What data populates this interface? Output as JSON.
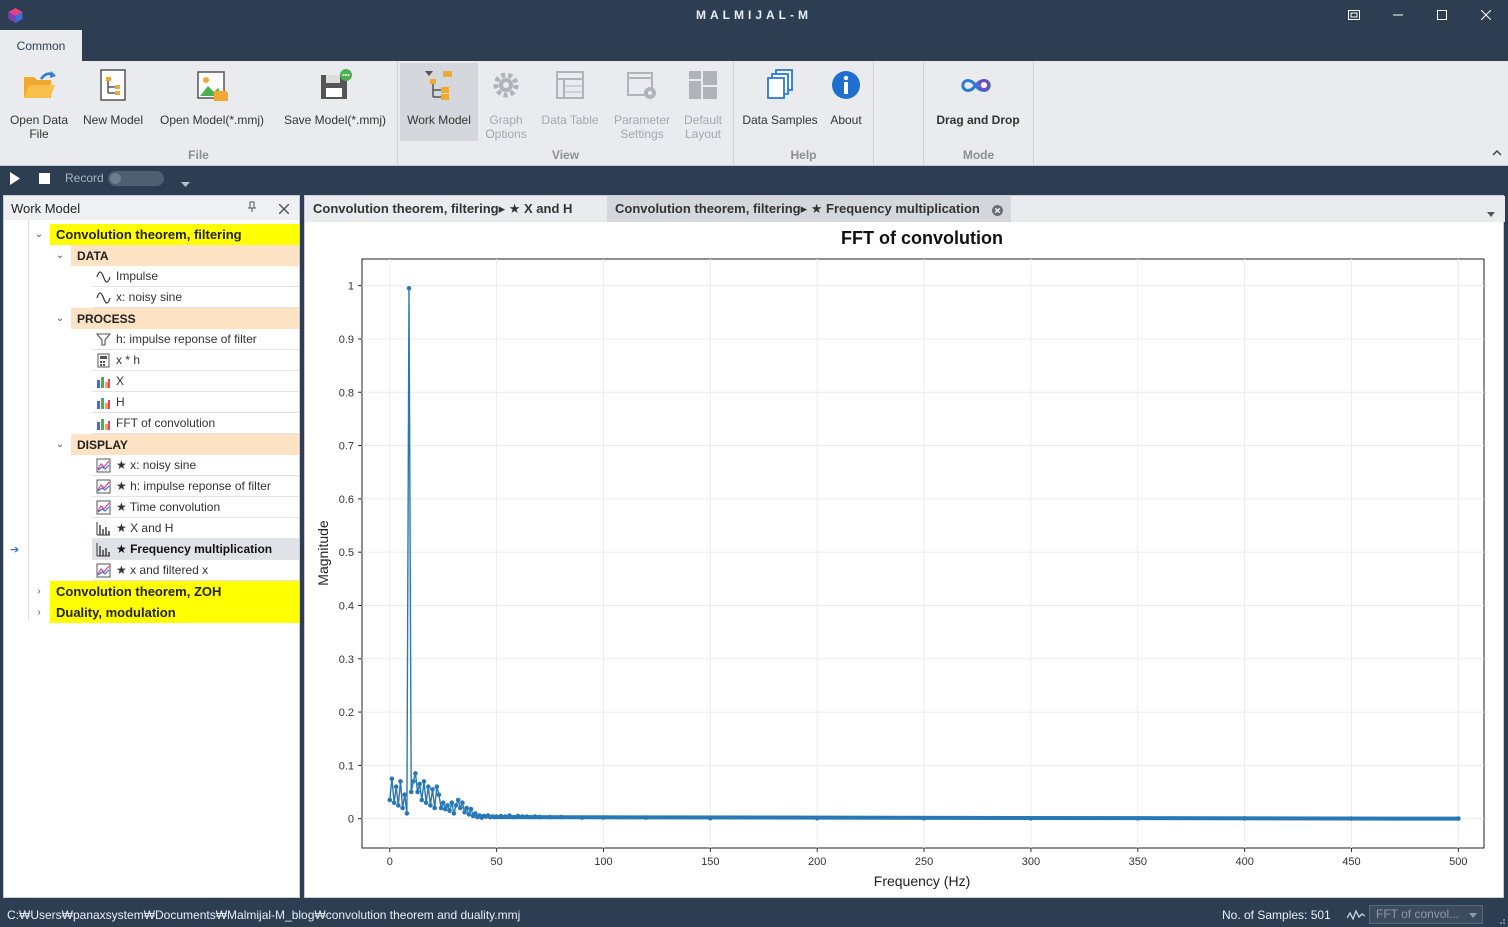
{
  "window": {
    "title": "MALMIJAL-M",
    "controls": [
      "restore",
      "minimize",
      "maximize",
      "close"
    ]
  },
  "ribbon": {
    "tab": "Common",
    "groups": [
      {
        "label": "File",
        "buttons": [
          {
            "label": "Open Data File",
            "icon": "open-folder-icon"
          },
          {
            "label": "New Model",
            "icon": "new-model-icon"
          },
          {
            "label": "Open Model(*.mmj)",
            "icon": "open-model-icon"
          },
          {
            "label": "Save Model(*.mmj)",
            "icon": "save-model-icon"
          }
        ]
      },
      {
        "label": "View",
        "buttons": [
          {
            "label": "Work Model",
            "icon": "work-model-icon",
            "active": true
          },
          {
            "label": "Graph Options",
            "icon": "gear-icon",
            "disabled": true
          },
          {
            "label": "Data Table",
            "icon": "table-icon",
            "disabled": true
          },
          {
            "label": "Parameter Settings",
            "icon": "parameter-settings-icon",
            "disabled": true
          },
          {
            "label": "Default Layout",
            "icon": "layout-icon",
            "disabled": true
          }
        ]
      },
      {
        "label": "Help",
        "buttons": [
          {
            "label": "Data Samples",
            "icon": "data-samples-icon"
          },
          {
            "label": "About",
            "icon": "info-icon"
          }
        ]
      },
      {
        "label": "Mode",
        "buttons": [
          {
            "label": "Drag and Drop",
            "icon": "infinity-icon"
          }
        ]
      }
    ]
  },
  "recordbar": {
    "record_label": "Record"
  },
  "workmodel": {
    "title": "Work Model",
    "projects": [
      {
        "label": "Convolution theorem, filtering",
        "expanded": true
      },
      {
        "label": "Convolution theorem, ZOH",
        "expanded": false
      },
      {
        "label": "Duality, modulation",
        "expanded": false
      }
    ],
    "categories": [
      "DATA",
      "PROCESS",
      "DISPLAY"
    ],
    "items": {
      "data": [
        "Impulse",
        "x: noisy sine"
      ],
      "process": [
        "h: impulse reponse of filter",
        "x * h",
        "X",
        "H",
        "FFT of convolution"
      ],
      "display": [
        "★ x: noisy sine",
        "★ h: impulse reponse of filter",
        "★ Time convolution",
        "★ X and H",
        "★ Frequency multiplication",
        "★ x and filtered x"
      ]
    },
    "selected_item": "★ Frequency multiplication"
  },
  "doc_tabs": [
    {
      "label": "Convolution theorem, filtering▸ ★ X and H",
      "active": false
    },
    {
      "label": "Convolution theorem, filtering▸ ★ Frequency multiplication",
      "active": true
    }
  ],
  "chart_data": {
    "type": "line",
    "title": "FFT of convolution",
    "xlabel": "Frequency (Hz)",
    "ylabel": "Magnitude",
    "xlim": [
      -13,
      512
    ],
    "ylim": [
      -0.055,
      1.05
    ],
    "xticks": [
      0,
      50,
      100,
      150,
      200,
      250,
      300,
      350,
      400,
      450,
      500
    ],
    "yticks": [
      0,
      0.1,
      0.2,
      0.3,
      0.4,
      0.5,
      0.6,
      0.7,
      0.8,
      0.9,
      1
    ],
    "ytick_labels": [
      "0",
      "0.1",
      "0.2",
      "0.3",
      "0.4",
      "0.5",
      "0.6",
      "0.7",
      "0.8",
      "0.9",
      "1"
    ],
    "grid": true,
    "series": [
      {
        "color": "#2878b5",
        "x": [
          0,
          1,
          2,
          3,
          4,
          5,
          6,
          7,
          8,
          9,
          10,
          11,
          12,
          13,
          14,
          15,
          16,
          17,
          18,
          19,
          20,
          21,
          22,
          23,
          24,
          25,
          26,
          27,
          28,
          29,
          30,
          31,
          32,
          33,
          34,
          35,
          36,
          37,
          38,
          39,
          40,
          41,
          42,
          43,
          44,
          45,
          46,
          47,
          48,
          49,
          50,
          52,
          54,
          56,
          58,
          60,
          62,
          64,
          66,
          68,
          70,
          75,
          80,
          90,
          100,
          120,
          150,
          200,
          250,
          300,
          350,
          400,
          450,
          500
        ],
        "y": [
          0.035,
          0.075,
          0.03,
          0.06,
          0.025,
          0.07,
          0.02,
          0.045,
          0.01,
          0.995,
          0.05,
          0.07,
          0.085,
          0.05,
          0.065,
          0.035,
          0.07,
          0.03,
          0.06,
          0.025,
          0.055,
          0.02,
          0.06,
          0.045,
          0.02,
          0.03,
          0.018,
          0.025,
          0.015,
          0.03,
          0.01,
          0.025,
          0.035,
          0.02,
          0.03,
          0.012,
          0.02,
          0.008,
          0.018,
          0.005,
          0.01,
          0.003,
          0.006,
          0.002,
          0.005,
          0.004,
          0.006,
          0.003,
          0.004,
          0.003,
          0.004,
          0.005,
          0.004,
          0.006,
          0.003,
          0.005,
          0.004,
          0.004,
          0.003,
          0.004,
          0.003,
          0.003,
          0.003,
          0.002,
          0.002,
          0.002,
          0.001,
          0.001,
          0.001,
          0.0005,
          0.0005,
          0.0005,
          0.0003,
          0.0003
        ]
      }
    ]
  },
  "status": {
    "path": "C:₩Users₩panaxsystem₩Documents₩Malmijal-M_blog₩convolution theorem and duality.mmj",
    "samples": "No. of Samples: 501",
    "selector": "FFT of convol..."
  }
}
